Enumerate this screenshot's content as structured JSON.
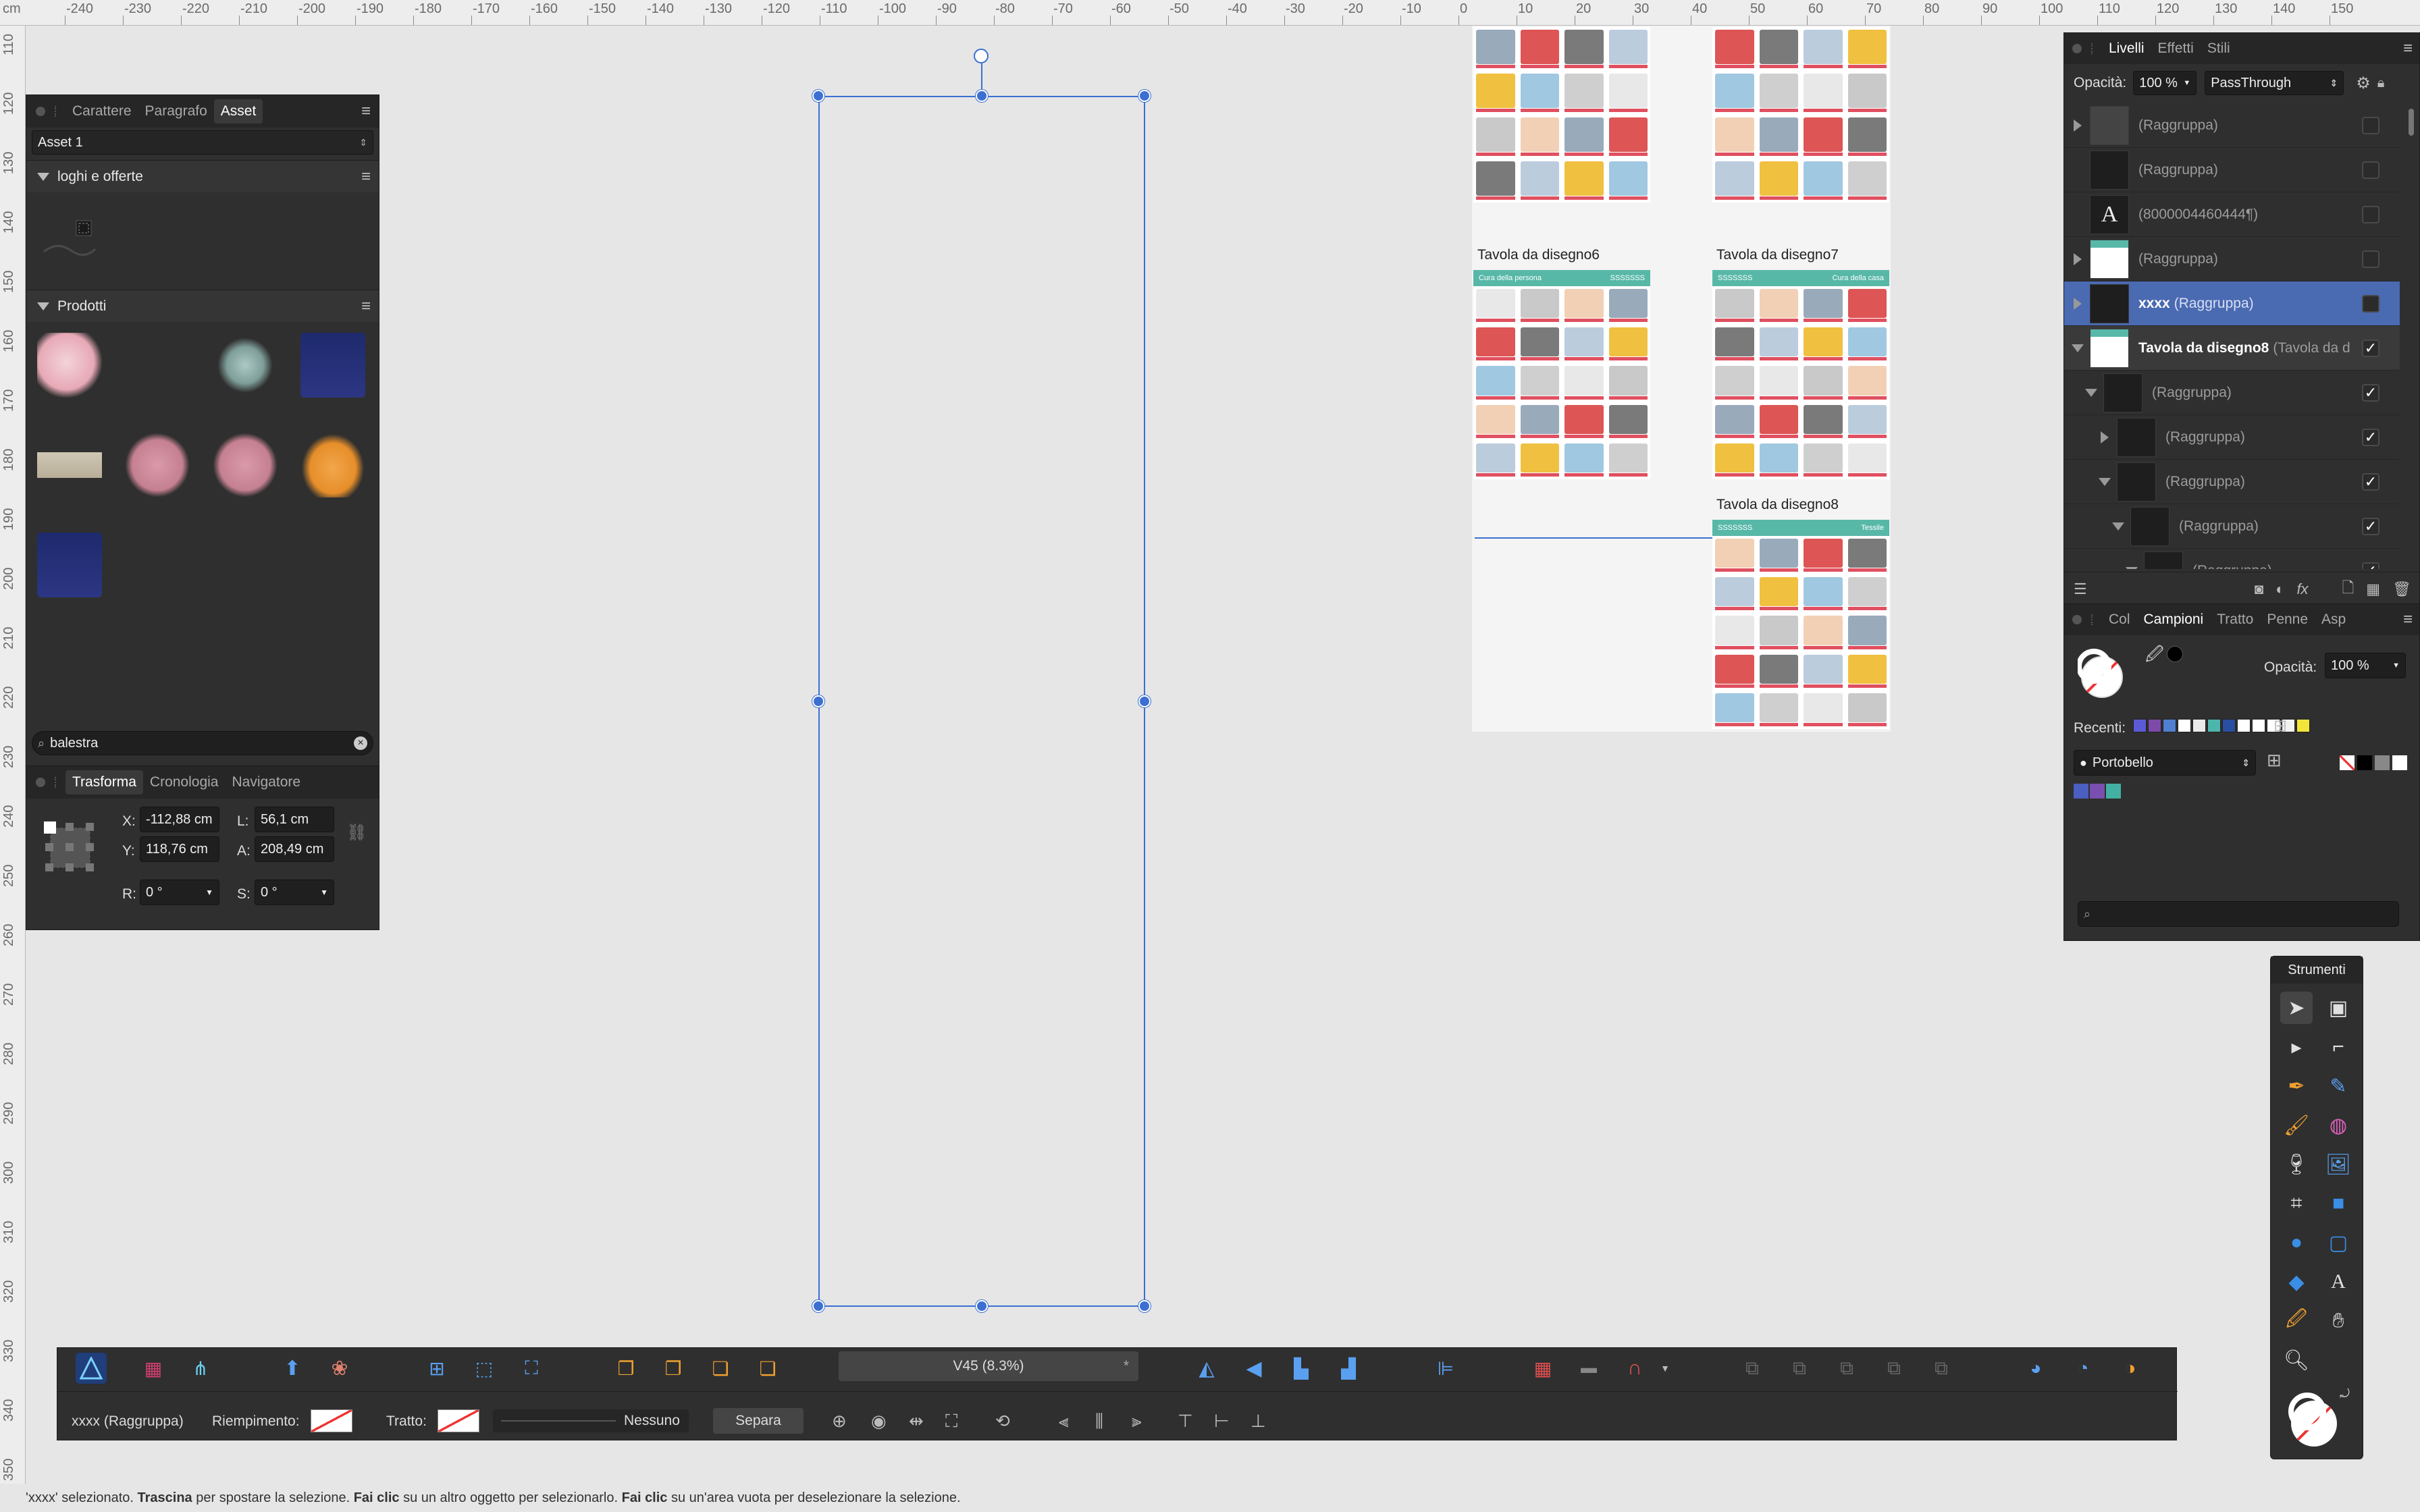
{
  "ruler": {
    "unit": "cm",
    "top_labels": [
      "-240",
      "-230",
      "-220",
      "-210",
      "-200",
      "-190",
      "-180",
      "-170",
      "-160",
      "-150",
      "-140",
      "-130",
      "-120",
      "-110",
      "-100",
      "-90",
      "-80",
      "-70",
      "-60",
      "-50",
      "-40",
      "-30",
      "-20",
      "-10",
      "0",
      "10",
      "20",
      "30",
      "40",
      "50",
      "60",
      "70",
      "80",
      "90",
      "100",
      "110",
      "120",
      "130",
      "140",
      "150"
    ],
    "left_labels": [
      "110",
      "120",
      "130",
      "140",
      "150",
      "160",
      "170",
      "180",
      "190",
      "200",
      "210",
      "220",
      "230",
      "240",
      "250",
      "260",
      "270",
      "280",
      "290",
      "300",
      "310",
      "320",
      "330",
      "340",
      "350"
    ]
  },
  "asset_panel": {
    "tabs": [
      "Carattere",
      "Paragrafo",
      "Asset"
    ],
    "active_tab": "Asset",
    "dropdown_value": "Asset 1",
    "section1": "loghi e offerte",
    "section2": "Prodotti",
    "search_value": "balestra"
  },
  "transform_panel": {
    "tabs": [
      "Trasforma",
      "Cronologia",
      "Navigatore"
    ],
    "x_label": "X:",
    "x_value": "-112,88 cm",
    "y_label": "Y:",
    "y_value": "118,76 cm",
    "w_label": "L:",
    "w_value": "56,1 cm",
    "h_label": "A:",
    "h_value": "208,49 cm",
    "r_label": "R:",
    "r_value": "0 °",
    "s_label": "S:",
    "s_value": "0 °"
  },
  "artboards": [
    {
      "title": "Tavola da disegno6",
      "banner_left": "Cura della persona",
      "banner_right": "SSSSSSS"
    },
    {
      "title": "Tavola da disegno7",
      "banner_left": "SSSSSSS",
      "banner_right": "Cura della casa"
    },
    {
      "title": "Tavola da disegno8",
      "banner_left": "SSSSSSS",
      "banner_right": "Tessile"
    }
  ],
  "layers_panel": {
    "tabs": [
      "Livelli",
      "Effetti",
      "Stili"
    ],
    "opacity_label": "Opacità:",
    "opacity_value": "100 %",
    "blend_mode": "PassThrough",
    "rows": [
      {
        "name": "(Raggruppa)",
        "extra": ""
      },
      {
        "name": "(Raggruppa)",
        "extra": ""
      },
      {
        "name": "(8000004460444¶)",
        "extra": ""
      },
      {
        "name": "(Raggruppa)",
        "extra": ""
      },
      {
        "name": "xxxx",
        "extra": "(Raggruppa)"
      },
      {
        "name": "Tavola da disegno8",
        "extra": "(Tavola da d"
      },
      {
        "name": "(Raggruppa)",
        "extra": ""
      },
      {
        "name": "(Raggruppa)",
        "extra": ""
      },
      {
        "name": "(Raggruppa)",
        "extra": ""
      },
      {
        "name": "(Raggruppa)",
        "extra": ""
      },
      {
        "name": "(Raggruppa)",
        "extra": ""
      }
    ],
    "text_glyph": "A",
    "fx_glyph": "fx"
  },
  "swatches_panel": {
    "tabs": [
      "Col",
      "Campioni",
      "Tratto",
      "Penne",
      "Asp"
    ],
    "active_tab": "Campioni",
    "opacity_label": "Opacità:",
    "opacity_value": "100 %",
    "recent_label": "Recenti:",
    "recent_colors": [
      "#5b5bd6",
      "#7d4aa8",
      "#4f7fd0",
      "#ffffff",
      "#eaeaea",
      "#4db6ac",
      "#2b4fa0",
      "#ffffff",
      "#ffffff",
      "#ffffff",
      "#f2f2f2",
      "#f2e53a"
    ],
    "palette_name": "Portobello",
    "palette_colors": [
      "#4a5fc1",
      "#7a4fb0",
      "#42b0a3"
    ]
  },
  "tools_panel": {
    "title": "Strumenti",
    "text_tool": "A"
  },
  "toolbar": {
    "zoom_label": "V45 (8.3%)",
    "zoom_star": "*"
  },
  "context_toolbar": {
    "selection_name": "xxxx (Raggruppa)",
    "fill_label": "Riempimento:",
    "stroke_label": "Tratto:",
    "stroke_style": "Nessuno",
    "separate_button": "Separa"
  },
  "status": {
    "part1": "'xxxx' selezionato. ",
    "b1": "Trascina",
    "part2": " per spostare la selezione. ",
    "b2": "Fai clic",
    "part3": " su un altro oggetto per selezionarlo. ",
    "b3": "Fai clic",
    "part4": " su un'area vuota per deselezionare la selezione."
  },
  "colors": {
    "accent": "#3b6fd1",
    "canvas": "#e6e6e6",
    "panel": "#2f2f2f",
    "teal": "#58b8a8"
  }
}
